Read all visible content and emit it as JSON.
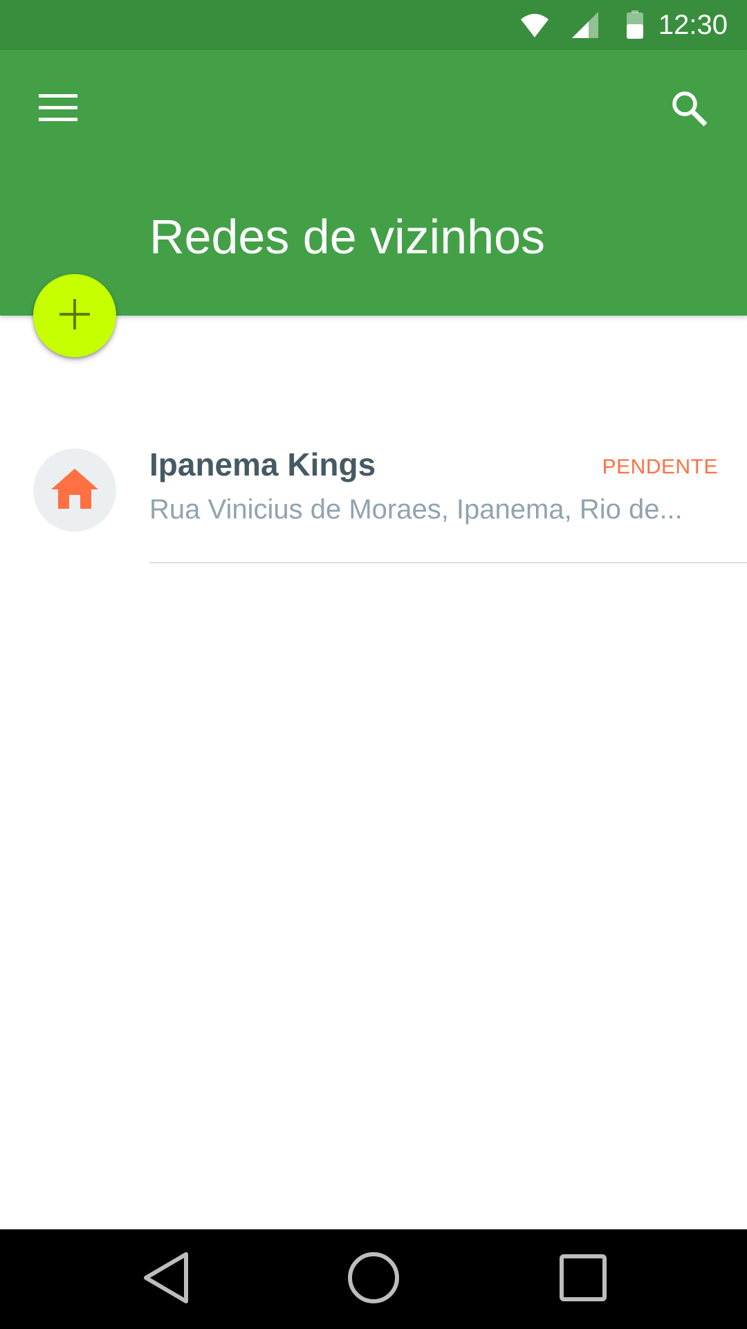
{
  "status_bar": {
    "time": "12:30",
    "icons": [
      "wifi-icon",
      "cell-signal-icon",
      "battery-icon"
    ]
  },
  "app_bar": {
    "title": "Redes de vizinhos",
    "menu_icon": "hamburger-menu-icon",
    "search_icon": "search-icon",
    "background_color": "#43a047",
    "status_bar_color": "#388e3c"
  },
  "fab": {
    "icon": "plus-icon",
    "color": "#c6ff00"
  },
  "networks": [
    {
      "icon": "home-icon",
      "icon_color": "#ff7043",
      "name": "Ipanema Kings",
      "address": "Rua Vinicius de Moraes, Ipanema, Rio de...",
      "status": "PENDENTE",
      "status_color": "#ff7043"
    }
  ],
  "nav_bar": {
    "icons": [
      "back-icon",
      "home-circle-icon",
      "recents-icon"
    ]
  }
}
